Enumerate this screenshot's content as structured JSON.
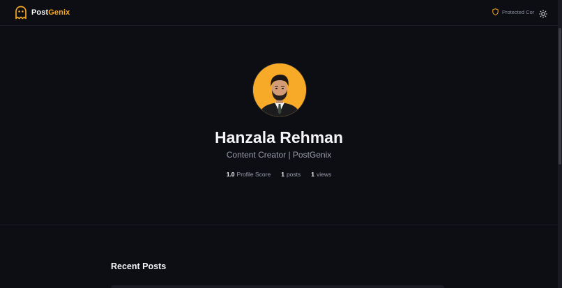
{
  "header": {
    "brand_part1": "Post",
    "brand_part2": "Genix",
    "protected_label": "Protected Cor",
    "theme_toggle_icon": "sun-icon"
  },
  "profile": {
    "name": "Hanzala Rehman",
    "tagline": "Content Creator | PostGenix",
    "avatar_bg": "#f7a928",
    "stats": [
      {
        "value": "1.0",
        "label": "Profile Score"
      },
      {
        "value": "1",
        "label": "posts"
      },
      {
        "value": "1",
        "label": "views"
      }
    ]
  },
  "recent_posts": {
    "title": "Recent Posts"
  },
  "colors": {
    "background": "#0d0e14",
    "accent": "#f5a623"
  }
}
